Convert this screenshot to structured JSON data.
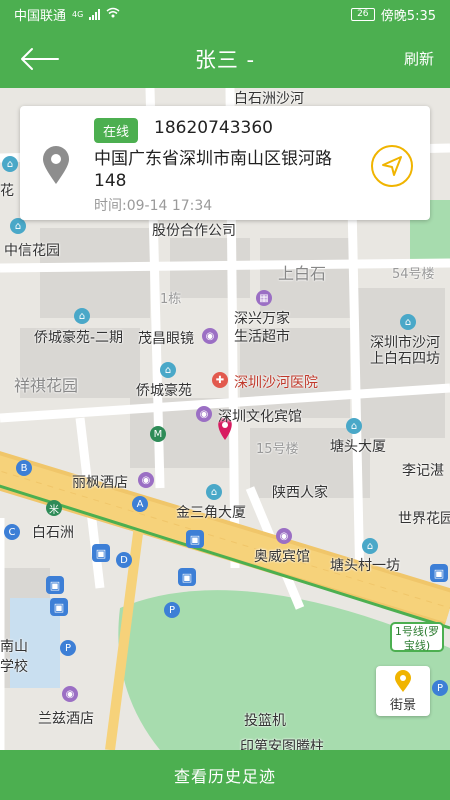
{
  "status_bar": {
    "carrier": "中国联通",
    "net_badge": "4G",
    "battery": "26",
    "time": "傍晚5:35"
  },
  "header": {
    "title": "张三 -",
    "refresh_label": "刷新",
    "back_icon": "arrow-left-icon"
  },
  "info_card": {
    "status": "在线",
    "phone": "18620743360",
    "address": "中国广东省深圳市南山区银河路148",
    "time": "时间:09-14 17:34",
    "accent": "#f0b400"
  },
  "map": {
    "labels": [
      "白石洲沙河",
      "花",
      "股份合作公司",
      "中信花园",
      "上白石",
      "54号楼",
      "1栋",
      "深兴万家",
      "生活超市",
      "侨城豪苑-二期",
      "茂昌眼镜",
      "深圳市沙河",
      "上白石四坊",
      "祥祺花园",
      "深圳沙河医院",
      "侨城豪苑",
      "深圳文化宾馆",
      "15号楼",
      "塘头大厦",
      "李记湛",
      "丽枫酒店",
      "陕西人家",
      "白石洲",
      "金三角大厦",
      "世界花园",
      "奥威宾馆",
      "塘头村一坊",
      "南山",
      "学校",
      "兰兹酒店",
      "投篮机",
      "印第安图腾柱"
    ],
    "metro_badge": "1号线(罗宝线)",
    "colors": {
      "road": "#f6d27a",
      "park": "#a7dcae",
      "water": "#c9dff0",
      "block": "#d8d6d2"
    }
  },
  "street_view": {
    "label": "街景"
  },
  "footer": {
    "history_label": "查看历史足迹"
  }
}
